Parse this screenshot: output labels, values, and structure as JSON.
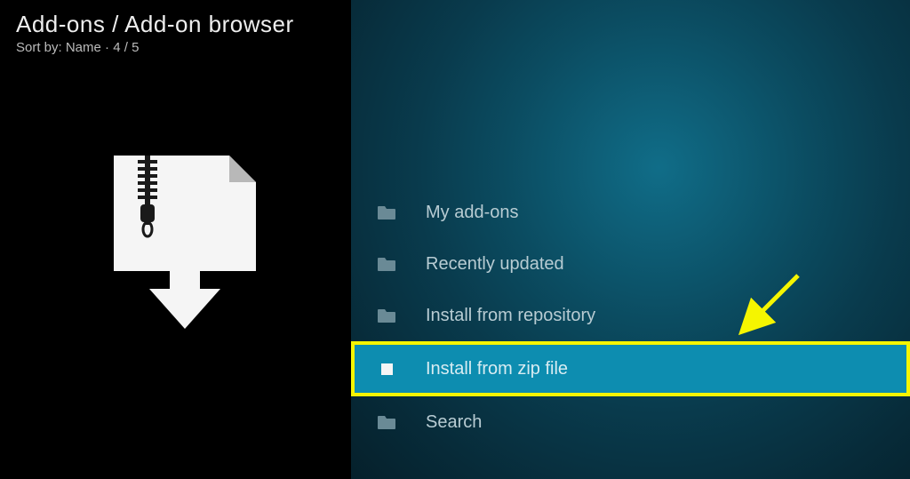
{
  "header": {
    "breadcrumb": "Add-ons / Add-on browser",
    "sort_label": "Sort by: Name",
    "position": "4 / 5"
  },
  "menu": {
    "items": [
      {
        "label": "My add-ons",
        "icon": "folder-icon",
        "highlighted": false
      },
      {
        "label": "Recently updated",
        "icon": "folder-icon",
        "highlighted": false
      },
      {
        "label": "Install from repository",
        "icon": "folder-icon",
        "highlighted": false
      },
      {
        "label": "Install from zip file",
        "icon": "zip-file-icon",
        "highlighted": true
      },
      {
        "label": "Search",
        "icon": "folder-icon",
        "highlighted": false
      }
    ]
  },
  "colors": {
    "highlight_border": "#f5f500",
    "highlight_bg": "#0d8db0",
    "arrow": "#f5f500"
  }
}
